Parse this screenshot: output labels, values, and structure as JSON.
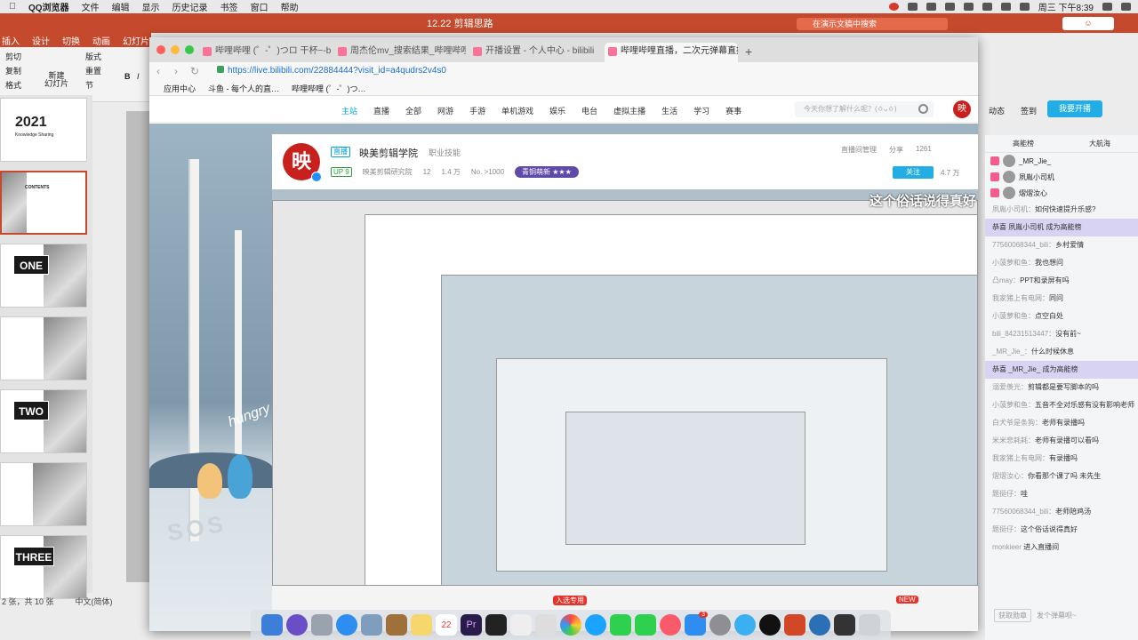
{
  "menubar": {
    "app": "QQ浏览器",
    "items": [
      "文件",
      "编辑",
      "显示",
      "历史记录",
      "书签",
      "窗口",
      "帮助"
    ],
    "clock": "周三 下午8:39"
  },
  "ppt": {
    "window_title": "12.22 剪辑思路",
    "search_placeholder": "在演示文稿中搜索",
    "tabs": [
      "插入",
      "设计",
      "切换",
      "动画",
      "幻灯片"
    ],
    "tools": {
      "cut": "剪切",
      "copy": "复制",
      "format": "格式",
      "new_slide": "新建\n幻灯片",
      "layout": "版式",
      "reset": "重置",
      "section": "节"
    },
    "slides": [
      {
        "label": "2021",
        "sub": "Knowledge Sharing"
      },
      {
        "label": "CONTENTS"
      },
      {
        "label": "ONE"
      },
      {
        "label": ""
      },
      {
        "label": "TWO"
      },
      {
        "label": ""
      },
      {
        "label": "THREE"
      }
    ],
    "status": {
      "slide": "2 张，共 10 张",
      "lang": "中文(简体)"
    }
  },
  "browser": {
    "tabs": [
      {
        "title": "哔哩哔哩 (゜-゜)つロ 干杯~-b"
      },
      {
        "title": "周杰伦mv_搜索结果_哔哩哔哩"
      },
      {
        "title": "开播设置 - 个人中心 - bilibili"
      },
      {
        "title": "哔哩哔哩直播，二次元弹幕直播"
      }
    ],
    "url": "https://live.bilibili.com/22884444?visit_id=a4qudrs2v4s0",
    "bookmarks": [
      "应用中心",
      "斗鱼 - 每个人的直…",
      "哔哩哔哩 (゜-゜)つ…"
    ]
  },
  "bili": {
    "nav": [
      "主站",
      "直播",
      "全部",
      "网游",
      "手游",
      "单机游戏",
      "娱乐",
      "电台",
      "虚拟主播",
      "生活",
      "学习",
      "赛事"
    ],
    "search_placeholder": "今天你想了解什么呢？(ㆁᴗㆁ)",
    "avatar": "映",
    "right_links": [
      "动态",
      "签到"
    ],
    "start_live": "我要开播"
  },
  "room": {
    "logo": "映",
    "category": "直播",
    "name": "映美剪辑学院",
    "sub": "职业技能",
    "level": "UP 9",
    "org": "映美剪辑研究院",
    "likes": "12",
    "gifts": "1.4 万",
    "rank": "No. >1000",
    "badge": "青铜萌新 ★★★",
    "manage": "直播间管理",
    "share": "分享",
    "viewers": "1261",
    "follow": "关注",
    "fans": "4.7 万",
    "subtitle": "这个俗话说得真好",
    "scene_text": {
      "hungry": "hungry",
      "sos": "SOS"
    }
  },
  "chat": {
    "tabs": [
      "高能榜",
      "大航海"
    ],
    "ranks": [
      "_MR_Jie_",
      "夙胤小司机",
      "熠熠汝心"
    ],
    "messages": [
      {
        "user": "夙胤小司机",
        "text": "如何快速提升乐感?"
      },
      {
        "user": "恭喜",
        "text": "夙胤小司机 成为高能榜",
        "highlight": true
      },
      {
        "user": "77560068344_bili",
        "text": "乡村爱情"
      },
      {
        "user": "小菠萝和鱼",
        "text": "我也想问"
      },
      {
        "user": "凸may",
        "text": "PPT和录屏有吗"
      },
      {
        "user": "我家猪上有电网",
        "text": "同问"
      },
      {
        "user": "小菠萝和鱼",
        "text": "点空白处"
      },
      {
        "user": "bili_84231513447",
        "text": "没有前~"
      },
      {
        "user": "_MR_Jie_",
        "text": "什么时候休息"
      },
      {
        "user": "恭喜",
        "text": "_MR_Jie_ 成为高能榜",
        "highlight": true
      },
      {
        "user": "溺爱羡光",
        "text": "剪辑都是要写脚本的吗"
      },
      {
        "user": "小菠萝和鱼",
        "text": "五音不全对乐感有没有影响老师"
      },
      {
        "user": "白犬爷是条狗",
        "text": "老师有录播吗"
      },
      {
        "user": "米米悲耗耗",
        "text": "老师有录播可以看吗"
      },
      {
        "user": "我家猪上有电网",
        "text": "有录播吗"
      },
      {
        "user": "熠熠汝心",
        "text": "你看那个课了吗 未先生"
      },
      {
        "user": "题挺仔",
        "text": "哇"
      },
      {
        "user": "77560068344_bili",
        "text": "老师陪鸡汤"
      },
      {
        "user": "题挺仔",
        "text": "这个俗话说得真好"
      },
      {
        "user": "monkieer",
        "text": "进入直播间"
      }
    ],
    "input_level": "获取勋章",
    "input_placeholder": "发个弹幕呗~"
  },
  "dock": {
    "labels": [
      "入选专用",
      "NEW"
    ],
    "badge": "3",
    "calendar_day": "22"
  },
  "colors": {
    "ppt": "#c5492d",
    "bili_blue": "#00a1d6",
    "bili_pink": "#fb7299",
    "live_blue": "#23ade5"
  }
}
